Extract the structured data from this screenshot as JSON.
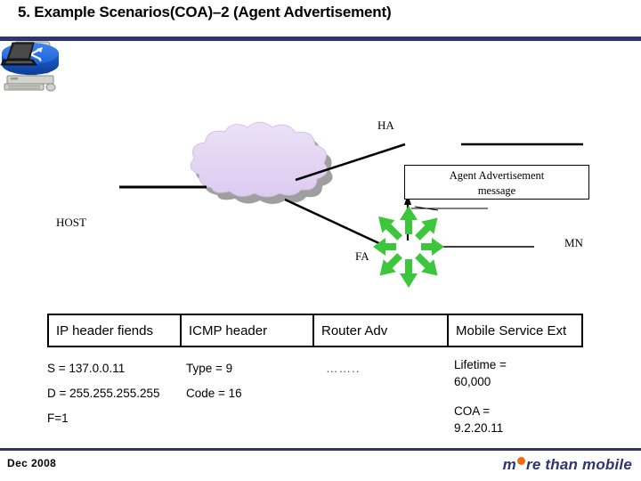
{
  "slide": {
    "title": "5. Example Scenarios(COA)–2 (Agent Advertisement)",
    "footer_date": "Dec  2008",
    "brand_pre": "m",
    "brand_post": "re than mobile",
    "rule_color": "#2e3570",
    "brand_dot_color": "#f06a16"
  },
  "diagram": {
    "nodes": [
      {
        "id": "host",
        "label": "HOST",
        "icon": "desktop-computer-icon"
      },
      {
        "id": "cloud",
        "label": "",
        "icon": "network-cloud-icon",
        "color": "#e2d3f2"
      },
      {
        "id": "ha-router",
        "label": "HA",
        "icon": "router-icon",
        "color": "#1f63d6"
      },
      {
        "id": "fa-router",
        "label": "FA",
        "icon": "router-icon",
        "color": "#1f63d6"
      },
      {
        "id": "mn-laptop",
        "label": "MN",
        "icon": "laptop-icon"
      }
    ],
    "callout": {
      "line1": "Agent Advertisement",
      "line2": "message"
    },
    "broadcast_arrow_color": "#3cc63c",
    "broadcast_arrow_count": 8
  },
  "table": {
    "headers": [
      "IP header fiends",
      "ICMP header",
      "Router Adv",
      "Mobile Service Ext"
    ],
    "columns": [
      {
        "name": "ip-header-fields",
        "lines": [
          "S = 137.0.0.11",
          "D = 255.255.255.255",
          "F=1"
        ]
      },
      {
        "name": "icmp-header",
        "lines": [
          "Type = 9",
          "Code = 16"
        ]
      },
      {
        "name": "router-adv",
        "lines": [
          "…….."
        ]
      },
      {
        "name": "mobile-service-ext",
        "lines": [
          "Lifetime =",
          "60,000",
          "COA =",
          "9.2.20.11"
        ]
      }
    ]
  }
}
